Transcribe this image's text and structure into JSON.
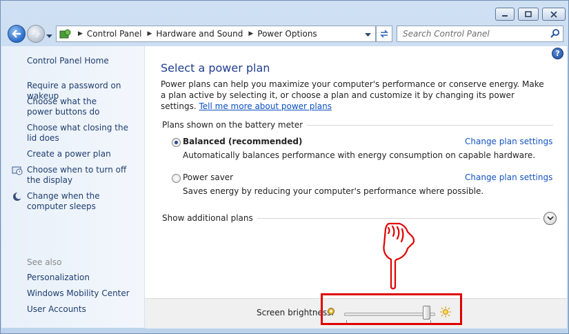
{
  "window": {
    "caption_buttons": [
      "minimize-icon",
      "maximize-icon",
      "close-icon"
    ]
  },
  "address_bar": {
    "crumbs": [
      "Control Panel",
      "Hardware and Sound",
      "Power Options"
    ]
  },
  "search": {
    "placeholder": "Search Control Panel"
  },
  "sidebar": {
    "home": "Control Panel Home",
    "items": [
      "Require a password on wakeup",
      "Choose what the power buttons do",
      "Choose what closing the lid does",
      "Create a power plan",
      "Choose when to turn off the display",
      "Change when the computer sleeps"
    ],
    "see_also_label": "See also",
    "see_also": [
      "Personalization",
      "Windows Mobility Center",
      "User Accounts"
    ]
  },
  "main": {
    "title": "Select a power plan",
    "intro": "Power plans can help you maximize your computer's performance or conserve energy. Make a plan active by selecting it, or choose a plan and customize it by changing its power settings.",
    "intro_link": "Tell me more about power plans",
    "group_label": "Plans shown on the battery meter",
    "plans": [
      {
        "name": "Balanced (recommended)",
        "selected": true,
        "description": "Automatically balances performance with energy consumption on capable hardware.",
        "link": "Change plan settings"
      },
      {
        "name": "Power saver",
        "selected": false,
        "description": "Saves energy by reducing your computer's performance where possible.",
        "link": "Change plan settings"
      }
    ],
    "additional_plans": "Show additional plans"
  },
  "footer": {
    "brightness_label": "Screen brightness:",
    "brightness_fraction": 0.95
  },
  "colors": {
    "link": "#1353c2",
    "title": "#1e3d8f",
    "annotation": "#e00000"
  }
}
